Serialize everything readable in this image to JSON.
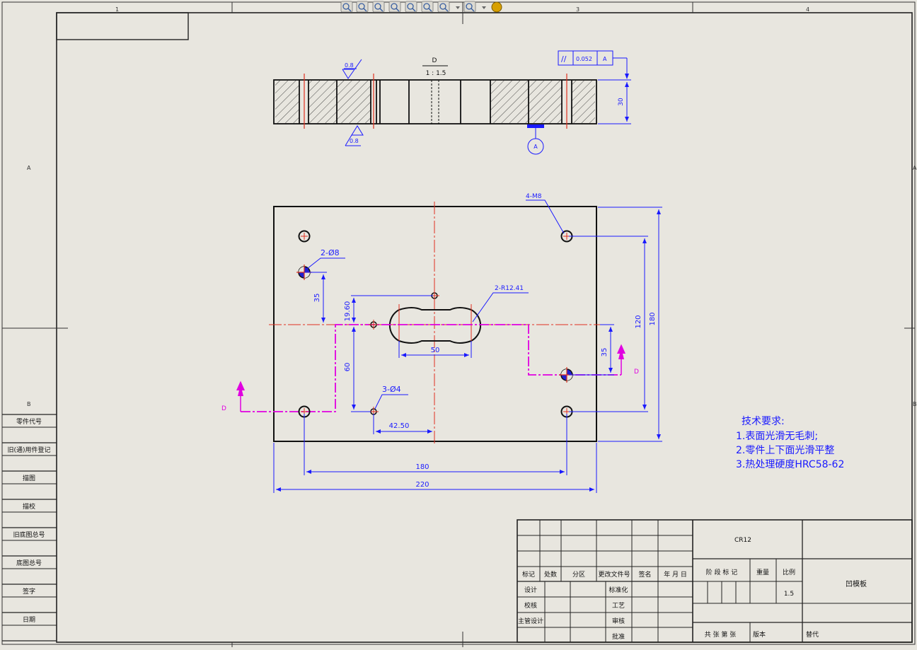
{
  "toolbar": {
    "icons": [
      "zoom-to-fit-icon",
      "zoom-to-area-icon",
      "zoom-in-out-icon",
      "select-icon",
      "rotate-icon",
      "view-orientation-icon",
      "display-style-icon",
      "hide-show-icon",
      "appearance-icon"
    ]
  },
  "border": {
    "zones_top": [
      "1",
      "3",
      "4"
    ],
    "zones_side": [
      "A",
      "B"
    ]
  },
  "left_stamp": {
    "rows": [
      "零件代号",
      "旧(通)用件登记",
      "描图",
      "描校",
      "旧底图总号",
      "底图总号",
      "签字",
      "日期"
    ]
  },
  "section_view": {
    "label": "D",
    "scale": "1 : 1.5",
    "roughness": "0.8",
    "gdt": {
      "symbol": "//",
      "tolerance": "0.052",
      "datum": "A"
    },
    "datum_label": "A",
    "thickness": "30"
  },
  "plan_view": {
    "holes_m8": "4-M8",
    "holes_d8": "2-Ø8",
    "holes_d4": "3-Ø4",
    "slot_radius": "2-R12.41",
    "dims": {
      "d35_left": "35",
      "d19_60": "19.60",
      "d60": "60",
      "d50": "50",
      "d42_50": "42.50",
      "d180_h": "180",
      "d220": "220",
      "d120": "120",
      "d180_v": "180",
      "d35_right": "35"
    },
    "cut_label_left": "D",
    "cut_label_right": "D"
  },
  "notes": {
    "title": "技术要求:",
    "items": [
      "1.表面光滑无毛刺;",
      "2.零件上下面光滑平整",
      "3.热处理硬度HRC58-62"
    ]
  },
  "title_block": {
    "headers": [
      "标记",
      "处数",
      "分区",
      "更改文件号",
      "签名",
      "年 月 日"
    ],
    "rows": [
      "设计",
      "校核",
      "主管设计"
    ],
    "std_rows": [
      "标准化",
      "工艺",
      "审核",
      "批准"
    ],
    "material": "CR12",
    "stage_mark": "阶 段 标 记",
    "weight": "重量",
    "scale_label": "比例",
    "scale_value": "1.5",
    "part_name": "凹模板",
    "sheets": "共  张  第  张",
    "version": "版本",
    "replaces": "替代"
  }
}
